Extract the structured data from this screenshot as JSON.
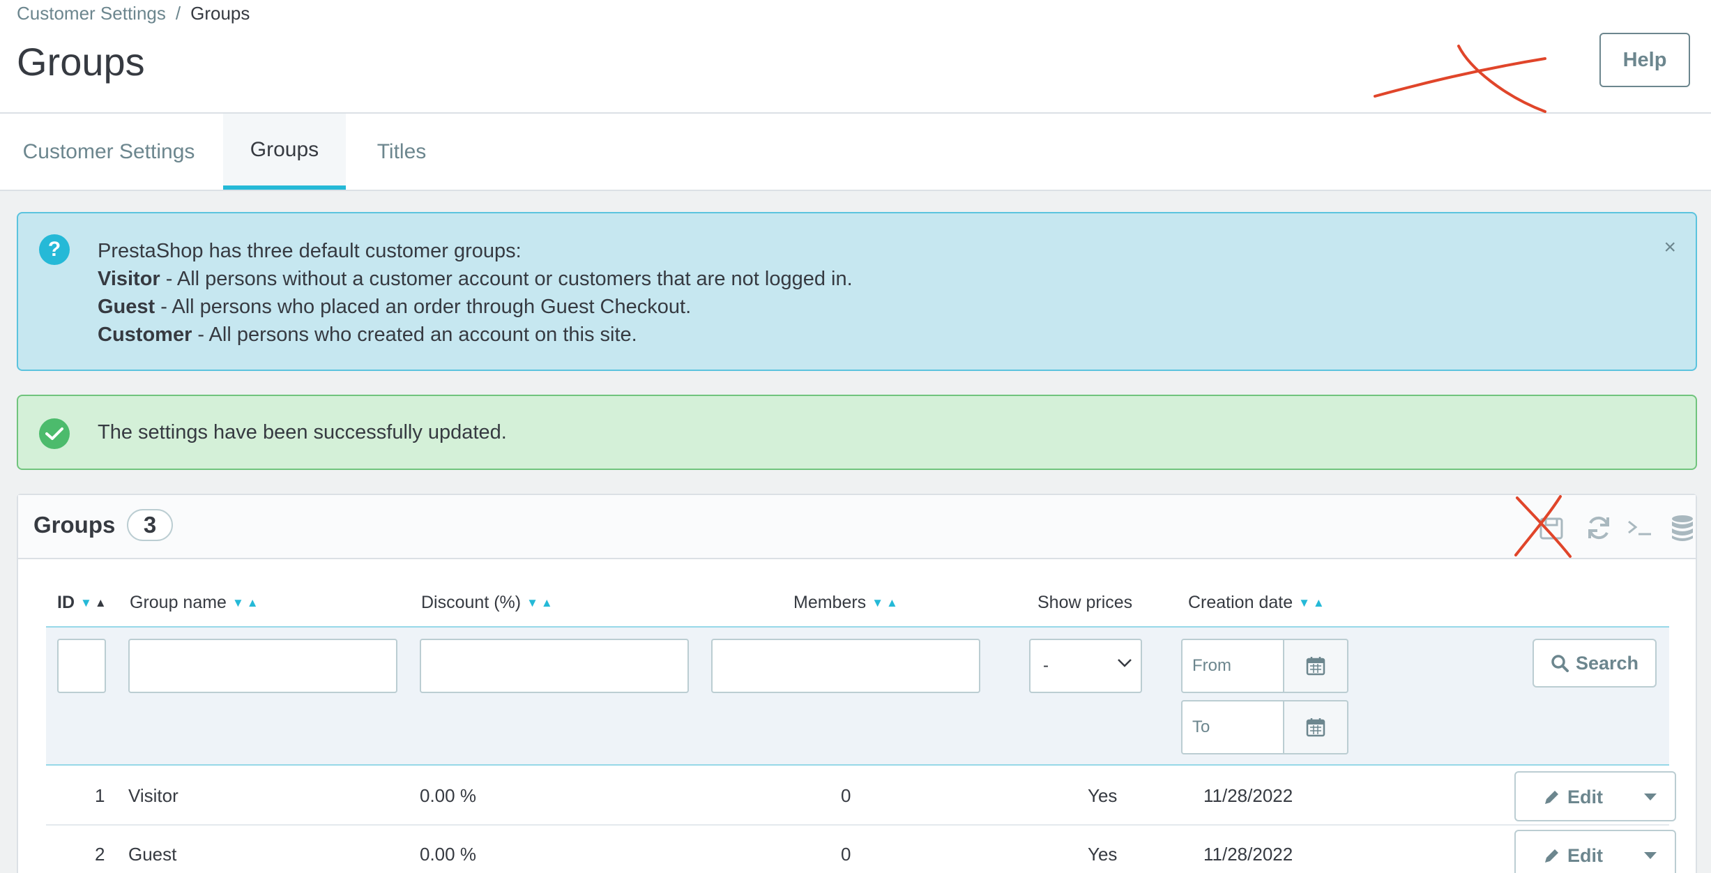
{
  "breadcrumb": {
    "parent": "Customer Settings",
    "separator": "/",
    "current": "Groups"
  },
  "page": {
    "title": "Groups",
    "help_label": "Help"
  },
  "tabs": [
    {
      "label": "Customer Settings",
      "active": false
    },
    {
      "label": "Groups",
      "active": true
    },
    {
      "label": "Titles",
      "active": false
    }
  ],
  "info_alert": {
    "intro": "PrestaShop has three default customer groups:",
    "items": [
      {
        "name": "Visitor",
        "desc": " - All persons without a customer account or customers that are not logged in."
      },
      {
        "name": "Guest",
        "desc": " - All persons who placed an order through Guest Checkout."
      },
      {
        "name": "Customer",
        "desc": " - All persons who created an account on this site."
      }
    ],
    "close": "×"
  },
  "success_alert": {
    "text": "The settings have been successfully updated."
  },
  "panel": {
    "title": "Groups",
    "count": "3",
    "toolbar_icons": [
      "export-icon",
      "refresh-icon",
      "sql-query-icon",
      "database-icon"
    ]
  },
  "table": {
    "headers": {
      "id": "ID",
      "group_name": "Group name",
      "discount": "Discount (%)",
      "members": "Members",
      "show_prices": "Show prices",
      "creation_date": "Creation date"
    },
    "filters": {
      "show_prices_selected": "-",
      "date_from_placeholder": "From",
      "date_to_placeholder": "To",
      "search_label": "Search"
    },
    "rows": [
      {
        "id": "1",
        "name": "Visitor",
        "discount": "0.00 %",
        "members": "0",
        "show_prices": "Yes",
        "date": "11/28/2022",
        "action": "Edit"
      },
      {
        "id": "2",
        "name": "Guest",
        "discount": "0.00 %",
        "members": "0",
        "show_prices": "Yes",
        "date": "11/28/2022",
        "action": "Edit"
      }
    ]
  },
  "colors": {
    "accent": "#25b9d7",
    "info_bg": "#c6e7f0",
    "success_bg": "#d4f0d8",
    "annotation_red": "#e0452a"
  }
}
